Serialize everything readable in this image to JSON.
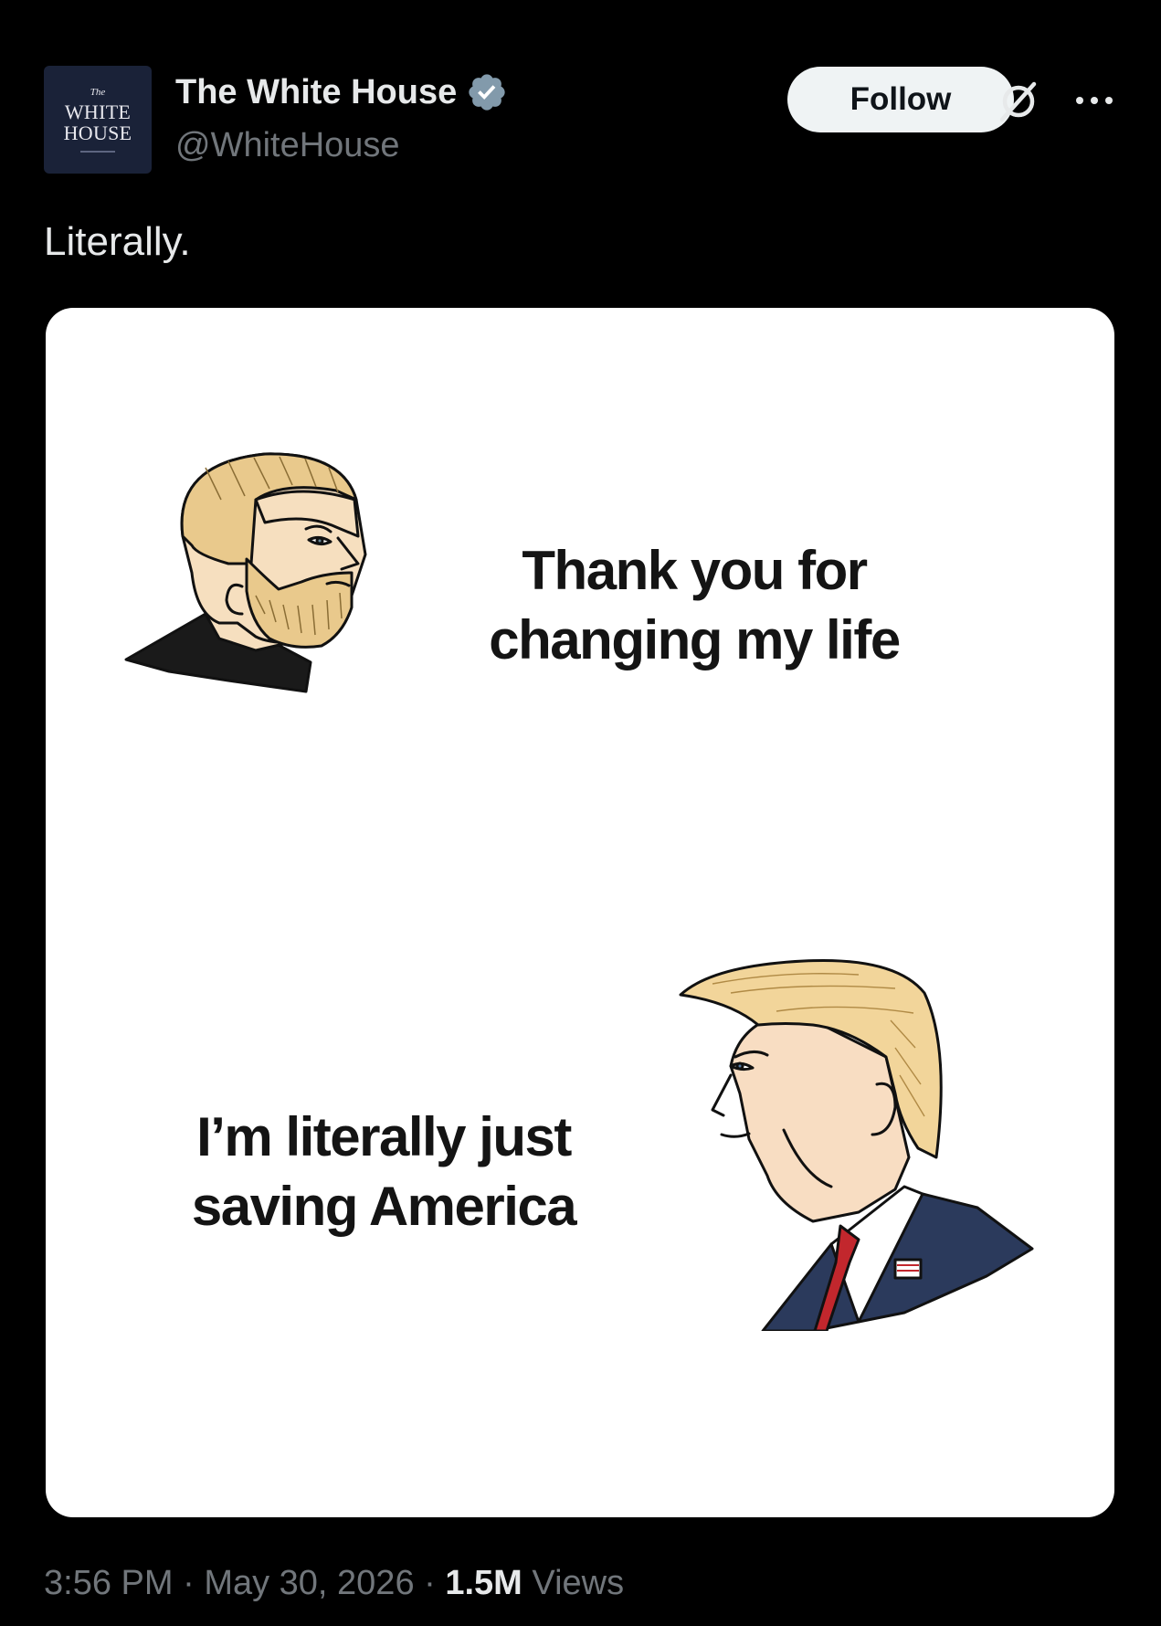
{
  "header": {
    "avatar": {
      "line1": "The",
      "line2": "WHITE",
      "line3": "HOUSE"
    },
    "display_name": "The White House",
    "handle": "@WhiteHouse",
    "follow_label": "Follow",
    "verified_icon": "verified-badge-icon",
    "grok_icon": "grok-icon",
    "more_icon": "more-icon"
  },
  "tweet": {
    "text": "Literally."
  },
  "media": {
    "top_caption": {
      "line1": "Thank you for",
      "line2": "changing my life"
    },
    "bottom_caption": {
      "line1": "I’m literally just",
      "line2": "saving America"
    }
  },
  "footer": {
    "time": "3:56 PM",
    "separator": " · ",
    "date": "May 30, 2026",
    "views_count": "1.5M",
    "views_label": "Views"
  },
  "colors": {
    "background": "#000000",
    "primary_text": "#e7e9ea",
    "secondary_text": "#71767b",
    "verified": "#829aab",
    "follow_bg": "#eff3f4"
  }
}
